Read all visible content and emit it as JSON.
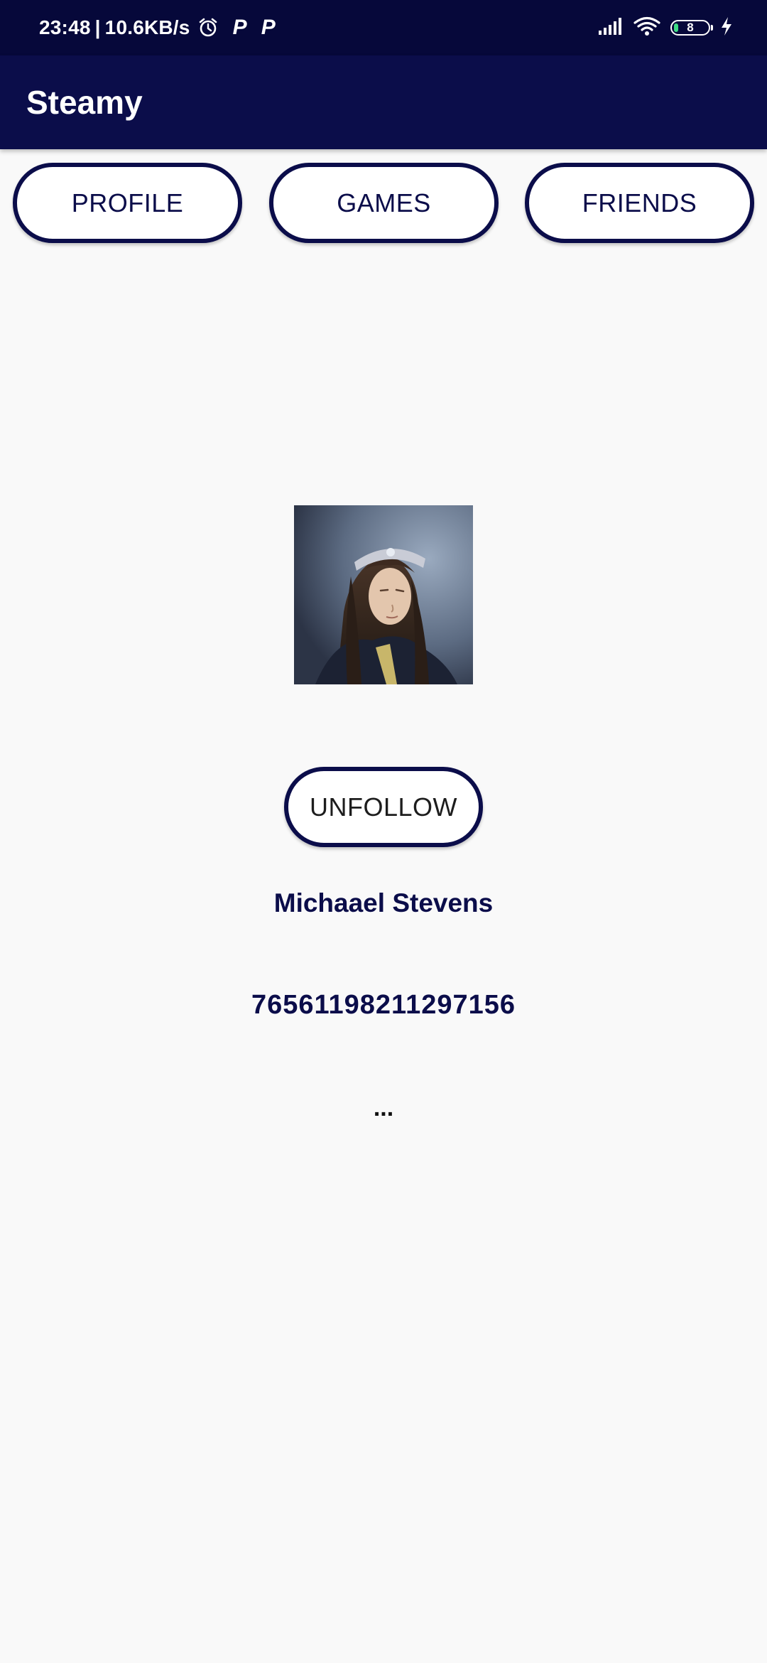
{
  "status_bar": {
    "time": "23:48",
    "network_speed": "10.6KB/s",
    "separator": "|",
    "notification_glyphs": [
      "P",
      "P"
    ],
    "battery_level": "8",
    "icons": [
      "alarm-icon",
      "signal-icon",
      "wifi-icon",
      "battery-icon",
      "charging-icon"
    ]
  },
  "app_bar": {
    "title": "Steamy"
  },
  "tabs": [
    {
      "label": "PROFILE"
    },
    {
      "label": "GAMES"
    },
    {
      "label": "FRIENDS"
    }
  ],
  "profile": {
    "follow_button_label": "UNFOLLOW",
    "name": "Michaael Stevens",
    "steam_id": "76561198211297156",
    "summary": "..."
  },
  "colors": {
    "status_bar_bg": "#06083a",
    "app_bar_bg": "#0b0d4a",
    "accent": "#0b0d4a",
    "page_bg": "#f9f9f9"
  }
}
